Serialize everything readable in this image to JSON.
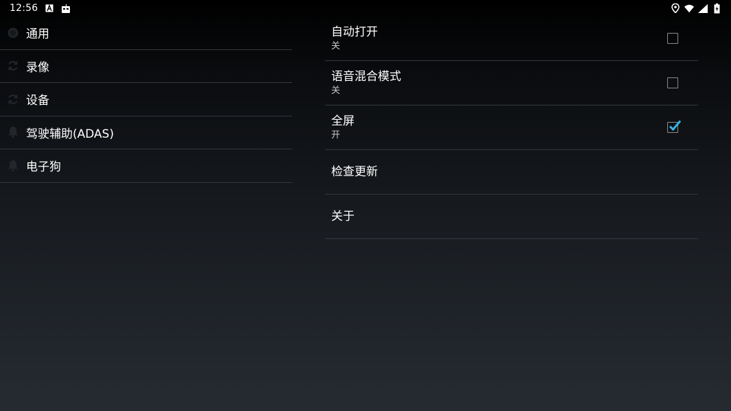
{
  "status_bar": {
    "time": "12:56",
    "left_icons": [
      "font-a-icon",
      "robot-icon"
    ],
    "right_icons": [
      "location-icon",
      "wifi-icon",
      "cell-signal-icon",
      "battery-charging-icon"
    ]
  },
  "categories": [
    {
      "label": "通用",
      "icon": "settings-icon"
    },
    {
      "label": "录像",
      "icon": "sync-icon"
    },
    {
      "label": "设备",
      "icon": "sync-icon"
    },
    {
      "label": "驾驶辅助(ADAS)",
      "icon": "bell-icon"
    },
    {
      "label": "电子狗",
      "icon": "bell-icon"
    }
  ],
  "preferences": [
    {
      "title": "自动打开",
      "summary": "关",
      "checked": false
    },
    {
      "title": "语音混合模式",
      "summary": "关",
      "checked": false
    },
    {
      "title": "全屏",
      "summary": "开",
      "checked": true
    },
    {
      "title": "检查更新"
    },
    {
      "title": "关于"
    }
  ],
  "colors": {
    "checkbox_accent": "#33b5e5",
    "divider": "#34383d"
  }
}
